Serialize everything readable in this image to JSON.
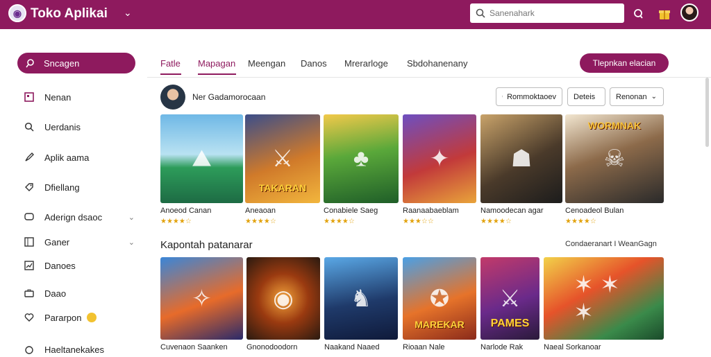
{
  "app": {
    "title": "Toko Aplikai"
  },
  "search": {
    "placeholder": "Sanenahark"
  },
  "sidebar": {
    "primary_label": "Sncagen",
    "items": [
      {
        "label": "Nenan",
        "icon": "apps-icon"
      },
      {
        "label": "Uerdanis",
        "icon": "search-icon"
      },
      {
        "label": "Aplik aama",
        "icon": "rocket-icon"
      },
      {
        "label": "Dfiellang",
        "icon": "tag-icon"
      },
      {
        "label": "Aderign dsaoc",
        "icon": "chat-icon",
        "expand": true
      },
      {
        "label": "Ganer",
        "icon": "grid-icon",
        "expand": true
      },
      {
        "label": "Danoes",
        "icon": "chart-icon"
      },
      {
        "label": "Daao",
        "icon": "briefcase-icon"
      },
      {
        "label": "Pararpon",
        "icon": "heart-icon",
        "badge": true
      },
      {
        "label": "Haeltanekakes",
        "icon": "circle-icon"
      }
    ]
  },
  "tabs": [
    "Fatle",
    "Mapagan",
    "Meengan",
    "Danos",
    "Mrerarloge",
    "Sbdohanenany"
  ],
  "active_tab": 0,
  "primary_button": "Tlepnkan elacian",
  "developer": {
    "name": "Ner Gadamorocaan"
  },
  "filters": {
    "sort": "Rommoktaoev",
    "details": "Deteis",
    "region": "Renonan"
  },
  "row1": [
    {
      "name": "Anoeod Canan",
      "tag": "",
      "rating": 4.5
    },
    {
      "name": "Aneaoan",
      "tag": "TAKARAN",
      "rating": 4.5
    },
    {
      "name": "Conabiele Saeg",
      "tag": "",
      "rating": 4.5
    },
    {
      "name": "Raanaabaeblam",
      "tag": "",
      "rating": 3.5
    },
    {
      "name": "Namoodecan agar",
      "tag": "",
      "rating": 4.5
    },
    {
      "name": "Cenoadeol Bulan",
      "tag": "WORMNAK",
      "rating": 4.5
    }
  ],
  "section2": {
    "title": "Kapontah patanarar",
    "link": "Condaeranart I WeanGagn"
  },
  "row2": [
    {
      "name": "Cuvenaon Saanken",
      "tag": ""
    },
    {
      "name": "Gnonodoodorn",
      "tag": ""
    },
    {
      "name": "Naakand Naaed",
      "tag": ""
    },
    {
      "name": "Rioaan Nale",
      "tag": "MAREKAR"
    },
    {
      "name": "Narlode Rak",
      "tag": "PAMES"
    },
    {
      "name": "Naeal Sorkanoar",
      "tag": ""
    }
  ],
  "colors": {
    "brand": "#8e1a5e",
    "star": "#e2a20c"
  }
}
